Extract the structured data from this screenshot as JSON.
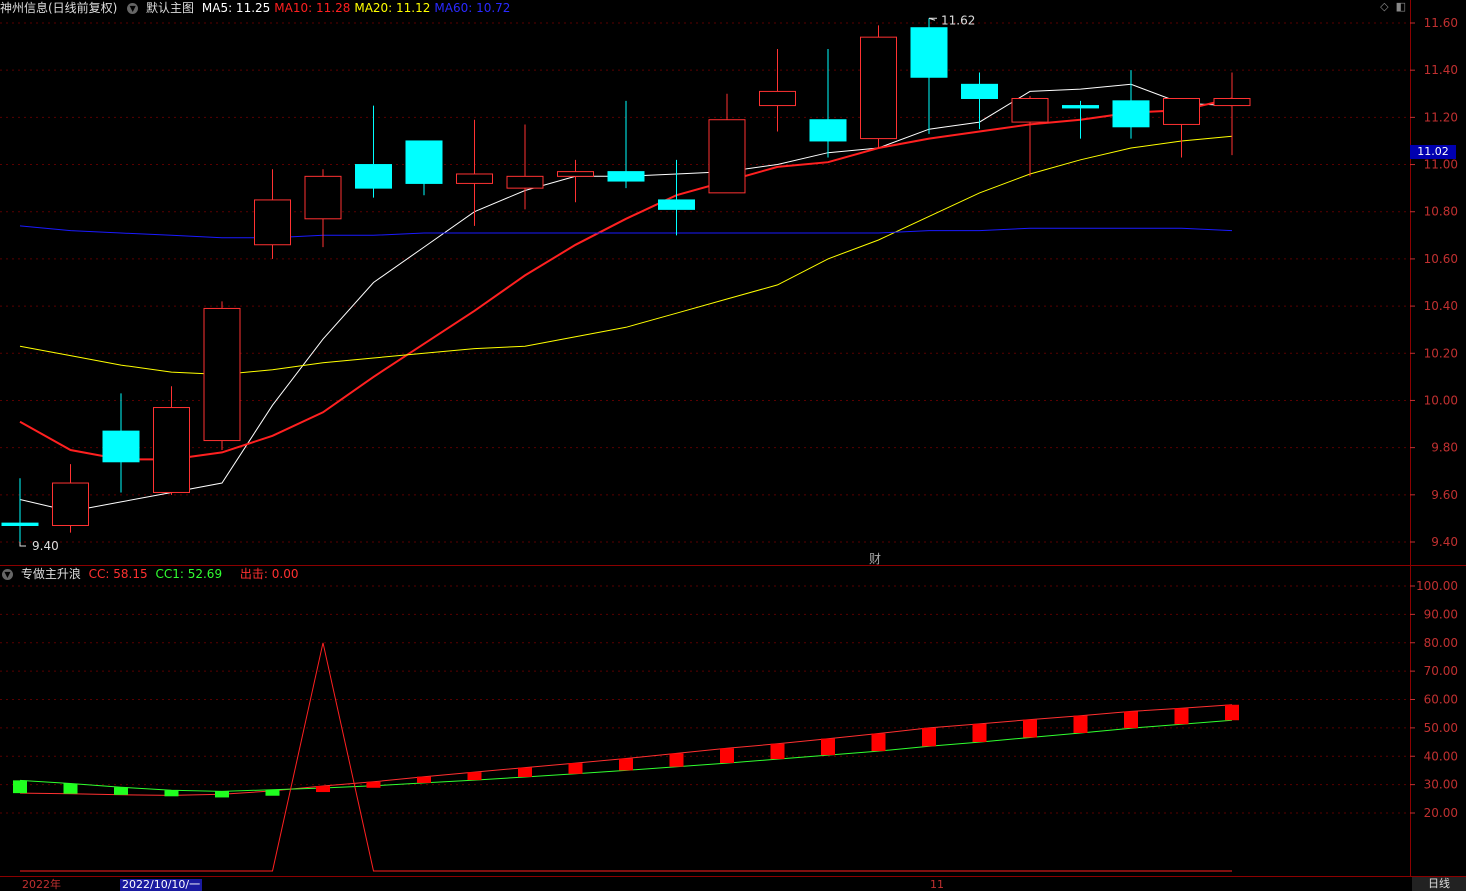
{
  "main_panel": {
    "title": "神州信息(日线前复权)",
    "indicator_name": "默认主图",
    "ma_labels": [
      {
        "text": "MA5: 11.25",
        "color": "#ffffff"
      },
      {
        "text": "MA10: 11.28",
        "color": "#ff2020"
      },
      {
        "text": "MA20: 11.12",
        "color": "#ffff00"
      },
      {
        "text": "MA60: 10.72",
        "color": "#2a2aff"
      }
    ],
    "high_marker": "11.62",
    "low_marker": "9.40",
    "current_price": "11.02",
    "finance_icon": "财",
    "y_ticks": [
      "11.60",
      "11.40",
      "11.20",
      "11.00",
      "10.80",
      "10.60",
      "10.40",
      "10.20",
      "10.00",
      "9.80",
      "9.60",
      "9.40"
    ]
  },
  "sub_panel": {
    "indicator_name": "专做主升浪",
    "cc_label": "CC: 58.15",
    "cc1_label": "CC1: 52.69",
    "out_label": "出击: 0.00",
    "y_ticks": [
      "100.00",
      "90.00",
      "80.00",
      "70.00",
      "60.00",
      "50.00",
      "40.00",
      "30.00",
      "20.00"
    ]
  },
  "date_bar": {
    "year": "2022年",
    "cursor_date": "2022/10/10/一",
    "month_11": "11"
  },
  "period_label": "日线",
  "colors": {
    "up": "#ff3232",
    "down": "#00ffff",
    "ma5": "#ffffff",
    "ma10": "#ff2020",
    "ma20": "#ffff00",
    "ma60": "#1a1aff",
    "cc1": "#30ff30"
  },
  "chart_data": [
    {
      "type": "candlestick",
      "title": "神州信息(日线前复权)",
      "ylim": [
        9.3,
        11.7
      ],
      "candles": [
        {
          "o": 9.48,
          "h": 9.67,
          "l": 9.4,
          "c": 9.47
        },
        {
          "o": 9.47,
          "h": 9.73,
          "l": 9.44,
          "c": 9.65
        },
        {
          "o": 9.87,
          "h": 10.03,
          "l": 9.61,
          "c": 9.74
        },
        {
          "o": 9.61,
          "h": 10.06,
          "l": 9.6,
          "c": 9.97
        },
        {
          "o": 9.83,
          "h": 10.42,
          "l": 9.79,
          "c": 10.39
        },
        {
          "o": 10.66,
          "h": 10.98,
          "l": 10.6,
          "c": 10.85
        },
        {
          "o": 10.77,
          "h": 10.98,
          "l": 10.65,
          "c": 10.95
        },
        {
          "o": 11.0,
          "h": 11.25,
          "l": 10.86,
          "c": 10.9
        },
        {
          "o": 11.1,
          "h": 11.1,
          "l": 10.87,
          "c": 10.92
        },
        {
          "o": 10.92,
          "h": 11.19,
          "l": 10.74,
          "c": 10.96
        },
        {
          "o": 10.9,
          "h": 11.17,
          "l": 10.81,
          "c": 10.95
        },
        {
          "o": 10.95,
          "h": 11.02,
          "l": 10.84,
          "c": 10.97
        },
        {
          "o": 10.97,
          "h": 11.27,
          "l": 10.9,
          "c": 10.93
        },
        {
          "o": 10.85,
          "h": 11.02,
          "l": 10.7,
          "c": 10.81
        },
        {
          "o": 10.88,
          "h": 11.3,
          "l": 10.88,
          "c": 11.19
        },
        {
          "o": 11.25,
          "h": 11.49,
          "l": 11.14,
          "c": 11.31
        },
        {
          "o": 11.19,
          "h": 11.49,
          "l": 11.03,
          "c": 11.1
        },
        {
          "o": 11.11,
          "h": 11.59,
          "l": 11.07,
          "c": 11.54
        },
        {
          "o": 11.58,
          "h": 11.62,
          "l": 11.13,
          "c": 11.37
        },
        {
          "o": 11.34,
          "h": 11.39,
          "l": 11.15,
          "c": 11.28
        },
        {
          "o": 11.18,
          "h": 11.29,
          "l": 10.95,
          "c": 11.28
        },
        {
          "o": 11.25,
          "h": 11.27,
          "l": 11.11,
          "c": 11.24
        },
        {
          "o": 11.27,
          "h": 11.4,
          "l": 11.11,
          "c": 11.16
        },
        {
          "o": 11.17,
          "h": 11.28,
          "l": 11.03,
          "c": 11.28
        },
        {
          "o": 11.25,
          "h": 11.39,
          "l": 11.04,
          "c": 11.28
        }
      ],
      "series": [
        {
          "name": "MA5",
          "values": [
            9.58,
            9.53,
            9.57,
            9.61,
            9.65,
            9.98,
            10.26,
            10.5,
            10.65,
            10.8,
            10.89,
            10.95,
            10.95,
            10.96,
            10.97,
            11.0,
            11.05,
            11.07,
            11.15,
            11.18,
            11.31,
            11.32,
            11.34,
            11.26,
            11.25
          ]
        },
        {
          "name": "MA10",
          "values": [
            9.91,
            9.79,
            9.75,
            9.75,
            9.78,
            9.85,
            9.95,
            10.1,
            10.24,
            10.38,
            10.53,
            10.66,
            10.77,
            10.87,
            10.93,
            10.99,
            11.01,
            11.07,
            11.11,
            11.14,
            11.17,
            11.19,
            11.22,
            11.23,
            11.28
          ]
        },
        {
          "name": "MA20",
          "values": [
            10.23,
            10.19,
            10.15,
            10.12,
            10.11,
            10.13,
            10.16,
            10.18,
            10.2,
            10.22,
            10.23,
            10.27,
            10.31,
            10.37,
            10.43,
            10.49,
            10.6,
            10.68,
            10.78,
            10.88,
            10.96,
            11.02,
            11.07,
            11.1,
            11.12
          ]
        },
        {
          "name": "MA60",
          "values": [
            10.74,
            10.72,
            10.71,
            10.7,
            10.69,
            10.69,
            10.7,
            10.7,
            10.71,
            10.71,
            10.71,
            10.71,
            10.71,
            10.71,
            10.71,
            10.71,
            10.71,
            10.71,
            10.72,
            10.72,
            10.73,
            10.73,
            10.73,
            10.73,
            10.72
          ]
        }
      ]
    },
    {
      "type": "line",
      "title": "专做主升浪",
      "ylim": [
        10,
        105
      ],
      "series": [
        {
          "name": "CC",
          "values": [
            27.0,
            26.8,
            26.4,
            26.2,
            26.6,
            27.8,
            29.5,
            31.0,
            32.8,
            34.4,
            36.0,
            37.6,
            39.2,
            41.0,
            42.8,
            44.4,
            46.2,
            48.0,
            50.0,
            51.4,
            52.9,
            54.3,
            55.8,
            56.9,
            58.15
          ]
        },
        {
          "name": "CC1",
          "values": [
            31.5,
            30.4,
            29.1,
            28.0,
            27.6,
            28.2,
            28.8,
            29.6,
            30.6,
            31.6,
            32.7,
            33.8,
            35.0,
            36.3,
            37.6,
            39.0,
            40.4,
            41.8,
            43.5,
            45.0,
            46.6,
            48.2,
            49.9,
            51.3,
            52.69
          ]
        },
        {
          "name": "出击",
          "values": [
            0,
            0,
            0,
            0,
            0,
            0,
            80,
            0,
            0,
            0,
            0,
            0,
            0,
            0,
            0,
            0,
            0,
            0,
            0,
            0,
            0,
            0,
            0,
            0,
            0
          ]
        }
      ]
    }
  ]
}
